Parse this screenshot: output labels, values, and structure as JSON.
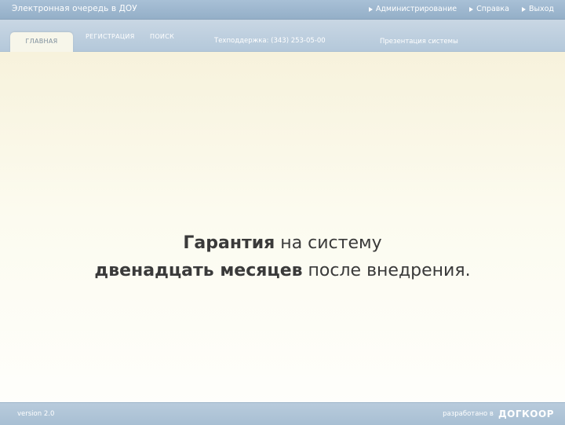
{
  "header": {
    "title": "Электронная очередь в ДОУ",
    "links": [
      {
        "label": "Администрирование"
      },
      {
        "label": "Справка"
      },
      {
        "label": "Выход"
      }
    ]
  },
  "nav": {
    "tabs": [
      {
        "label": "ГЛАВНАЯ",
        "active": true
      },
      {
        "label": "РЕГИСТРАЦИЯ"
      },
      {
        "label": "ПОИСК"
      }
    ],
    "support": "Техподдержка: (343) 253-05-00",
    "presentation": "Презентация системы"
  },
  "main": {
    "line1_bold": "Гарантия",
    "line1_rest": " на систему",
    "line2_bold": "двенадцать месяцев",
    "line2_rest": " после внедрения."
  },
  "footer": {
    "version": "version 2.0",
    "developed_by": "разработано в",
    "logo_text": "ДОГКООР"
  },
  "colors": {
    "header_bar": "#94afc8",
    "nav_band": "#b4c8da",
    "content_bg": "#fcfbef",
    "text": "#3a3a3a"
  }
}
